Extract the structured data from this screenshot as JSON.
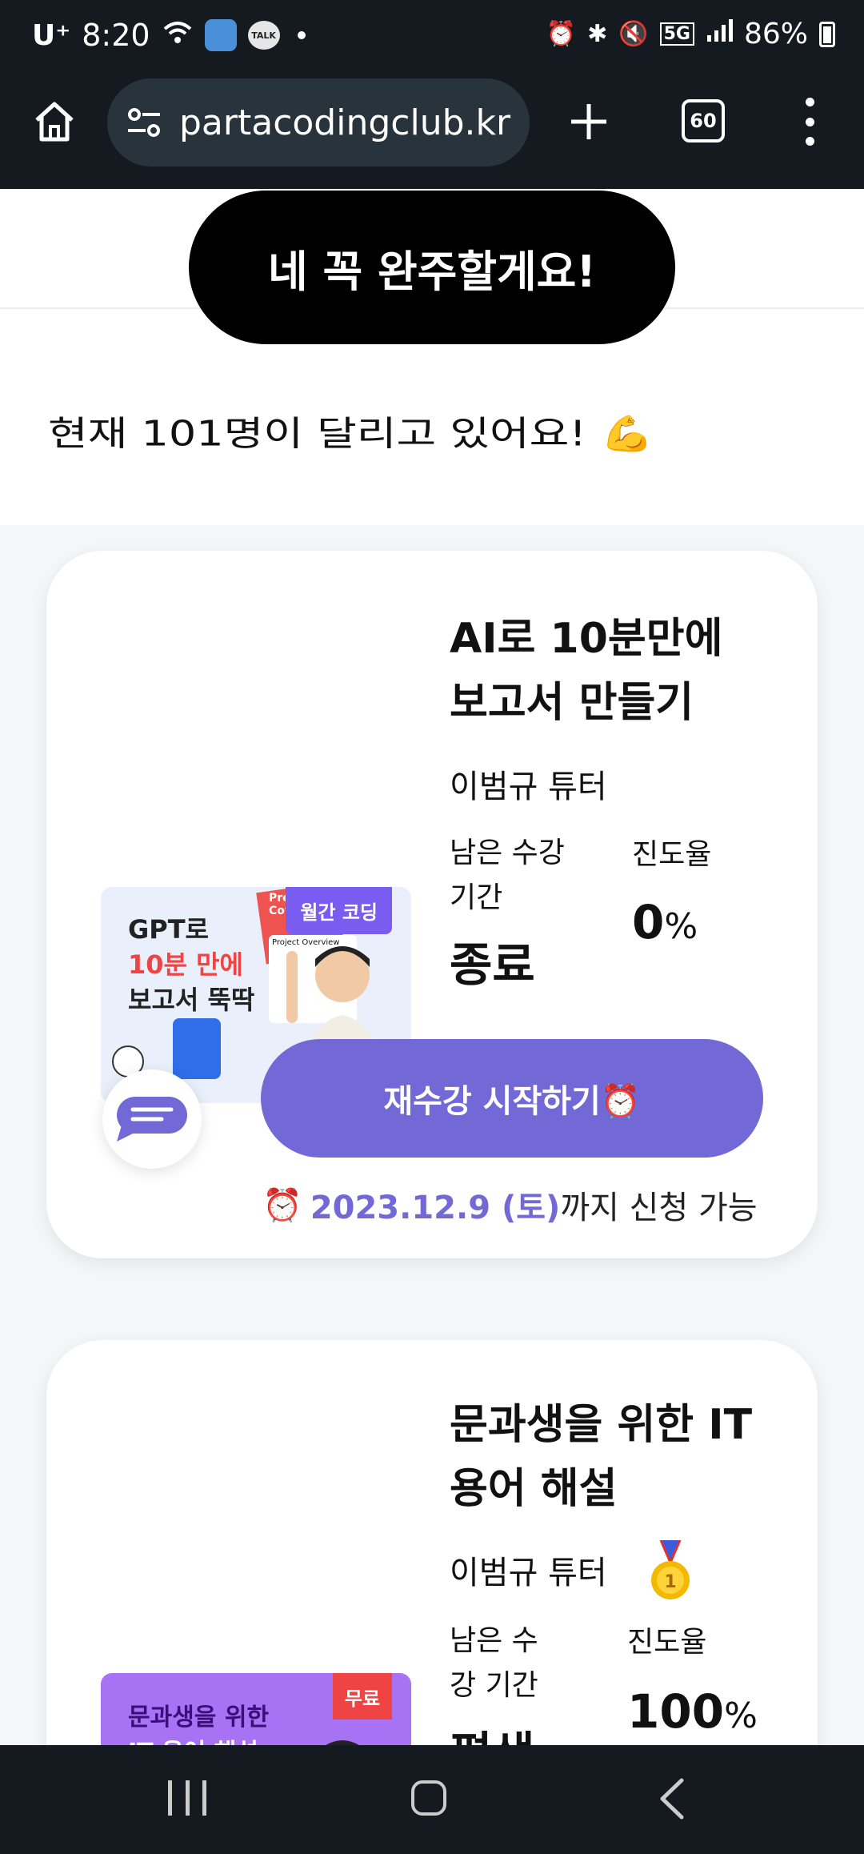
{
  "status_bar": {
    "carrier": "U⁺",
    "time": "8:20",
    "talk_label": "TALK",
    "network": "5G",
    "battery": "86%",
    "icons": [
      "wifi-icon",
      "photo-icon",
      "talk-icon",
      "alarm-icon",
      "bluetooth-icon",
      "mute-icon",
      "signal-icon",
      "battery-icon"
    ]
  },
  "browser": {
    "url": "partacodingclub.kr",
    "tab_count": "60"
  },
  "page": {
    "confirm_button": "네 꼭 완주할게요!",
    "runners_text": "현재 101명이 달리고 있어요! 💪"
  },
  "courses": [
    {
      "title_line1": "AI로 10분만에",
      "title_line2": "보고서 만들기",
      "tutor": "이범규 튜터",
      "remain_label_line1": "남은 수강",
      "remain_label_line2": "기간",
      "remain_value": "종료",
      "progress_label": "진도율",
      "progress_value": "0",
      "progress_unit": "%",
      "thumb": {
        "line1": "GPT로",
        "line2": "10분 만에",
        "line3": "보고서 뚝딱",
        "badge": "월간 코딩",
        "cover_text": "Presen Cover",
        "overview_text": "Project Overview"
      },
      "restart_button": "재수강 시작하기⏰",
      "deadline_icon": "⏰",
      "deadline_date": "2023.12.9 (토)",
      "deadline_suffix": "까지 신청 가능"
    },
    {
      "title_line1": "문과생을 위한 IT",
      "title_line2": "용어 해설",
      "tutor": "이범규 튜터",
      "remain_label_line1": "남은 수",
      "remain_label_line2": "강 기간",
      "remain_value": "평생",
      "progress_label": "진도율",
      "progress_value": "100",
      "progress_unit": "%",
      "thumb": {
        "line1": "문과생을 위한",
        "line2": "IT 용어 해설",
        "badge": "무료"
      }
    }
  ],
  "colors": {
    "accent_purple": "#7269d6",
    "dark_bar": "#141a20",
    "badge_red": "#ef4444"
  }
}
